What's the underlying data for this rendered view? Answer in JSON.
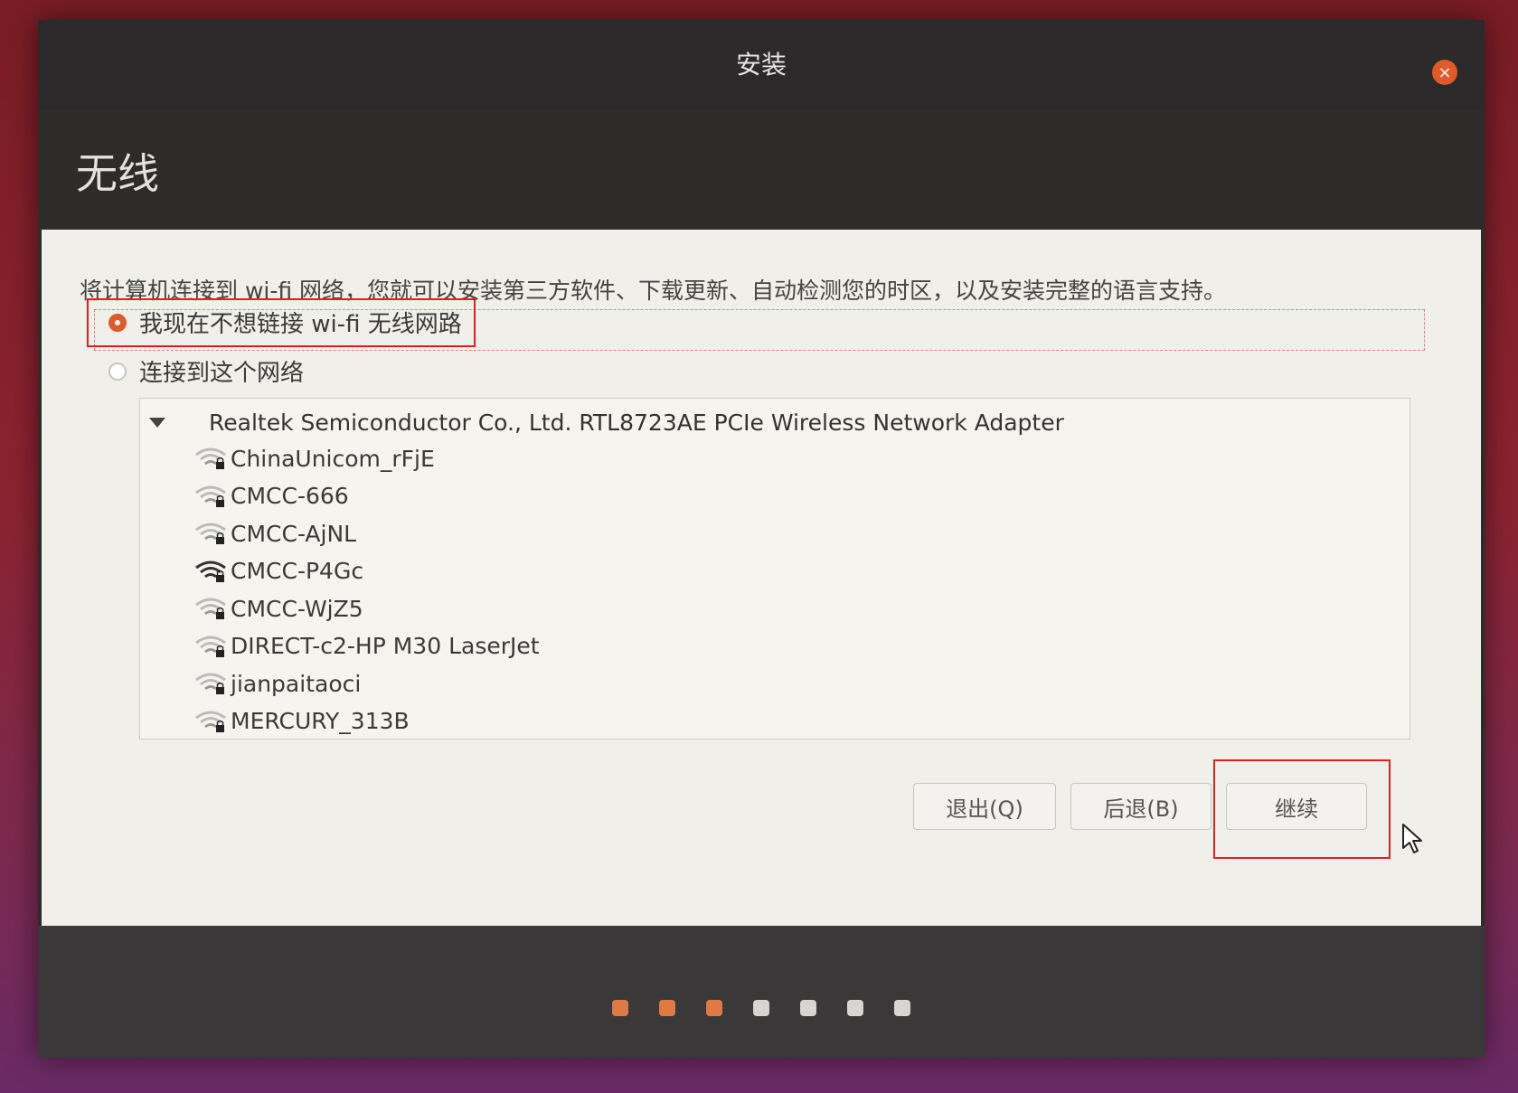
{
  "window": {
    "title": "安装",
    "close_icon": "×"
  },
  "header": {
    "page_title": "无线"
  },
  "content": {
    "intro": "将计算机连接到 wi-fi 网络，您就可以安装第三方软件、下载更新、自动检测您的时区，以及安装完整的语言支持。",
    "option_no_wifi": "我现在不想链接 wi-fi 无线网路",
    "option_connect": "连接到这个网络",
    "selected_option": "option_no_wifi",
    "adapter": "Realtek Semiconductor Co., Ltd. RTL8723AE PCIe Wireless Network Adapter",
    "networks": [
      {
        "ssid": "ChinaUnicom_rFjE",
        "locked": true,
        "signal": "weak"
      },
      {
        "ssid": "CMCC-666",
        "locked": true,
        "signal": "weak"
      },
      {
        "ssid": "CMCC-AjNL",
        "locked": true,
        "signal": "weak"
      },
      {
        "ssid": "CMCC-P4Gc",
        "locked": true,
        "signal": "strong"
      },
      {
        "ssid": "CMCC-WjZ5",
        "locked": true,
        "signal": "weak"
      },
      {
        "ssid": "DIRECT-c2-HP M30 LaserJet",
        "locked": true,
        "signal": "weak"
      },
      {
        "ssid": "jianpaitaoci",
        "locked": true,
        "signal": "weak"
      },
      {
        "ssid": "MERCURY_313B",
        "locked": true,
        "signal": "weak"
      }
    ]
  },
  "buttons": {
    "quit": "退出(Q)",
    "back": "后退(B)",
    "continue": "继续"
  },
  "progress": {
    "total_steps": 7,
    "completed_steps": 3
  },
  "colors": {
    "accent": "#e05a2a",
    "highlight_box": "#e02020"
  }
}
